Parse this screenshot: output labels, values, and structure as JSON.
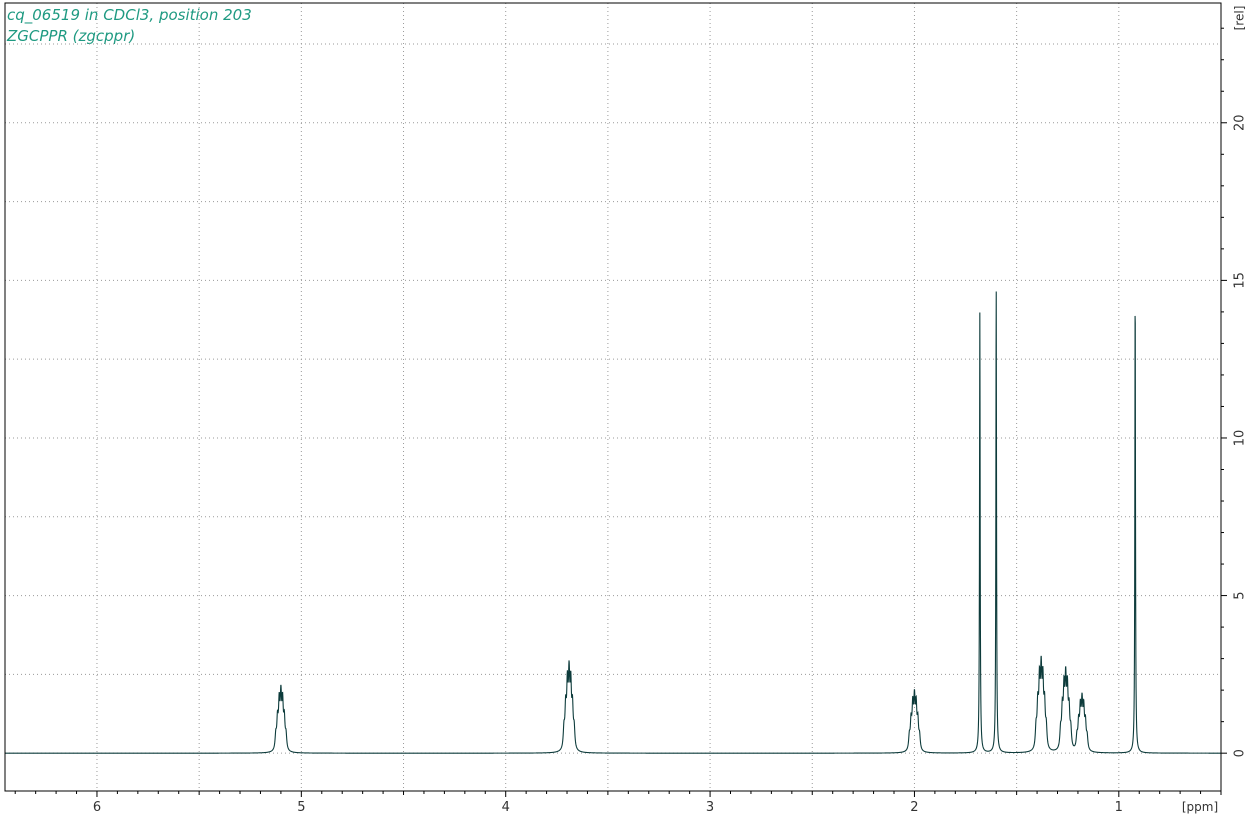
{
  "header": {
    "title": "cq_06519 in CDCl3, position 203",
    "subtitle": "ZGCPPR (zgcppr)"
  },
  "colors": {
    "spectrum": "#0d3b3b",
    "grid": "#9a9a9a",
    "title": "#1f9a82",
    "frame": "#000000"
  },
  "chart_data": {
    "type": "line",
    "title": "cq_06519 in CDCl3, position 203",
    "subtitle": "ZGCPPR (zgcppr)",
    "xlabel": "[ppm]",
    "ylabel": "[rel]",
    "xlim": [
      6.45,
      0.5
    ],
    "ylim": [
      -1.2,
      23.8
    ],
    "x_reversed": true,
    "x_ticks": [
      6,
      5,
      4,
      3,
      2,
      1
    ],
    "y_ticks": [
      0,
      5,
      10,
      15,
      20
    ],
    "grid": true,
    "legend": "none",
    "peaks": [
      {
        "ppm": 5.1,
        "height": 1.55
      },
      {
        "ppm": 3.69,
        "height": 2.1
      },
      {
        "ppm": 2.0,
        "height": 1.45
      },
      {
        "ppm": 1.68,
        "height": 14.0
      },
      {
        "ppm": 1.6,
        "height": 14.9
      },
      {
        "ppm": 1.38,
        "height": 2.2
      },
      {
        "ppm": 1.26,
        "height": 1.95
      },
      {
        "ppm": 1.18,
        "height": 1.35
      },
      {
        "ppm": 0.92,
        "height": 14.8
      }
    ]
  }
}
